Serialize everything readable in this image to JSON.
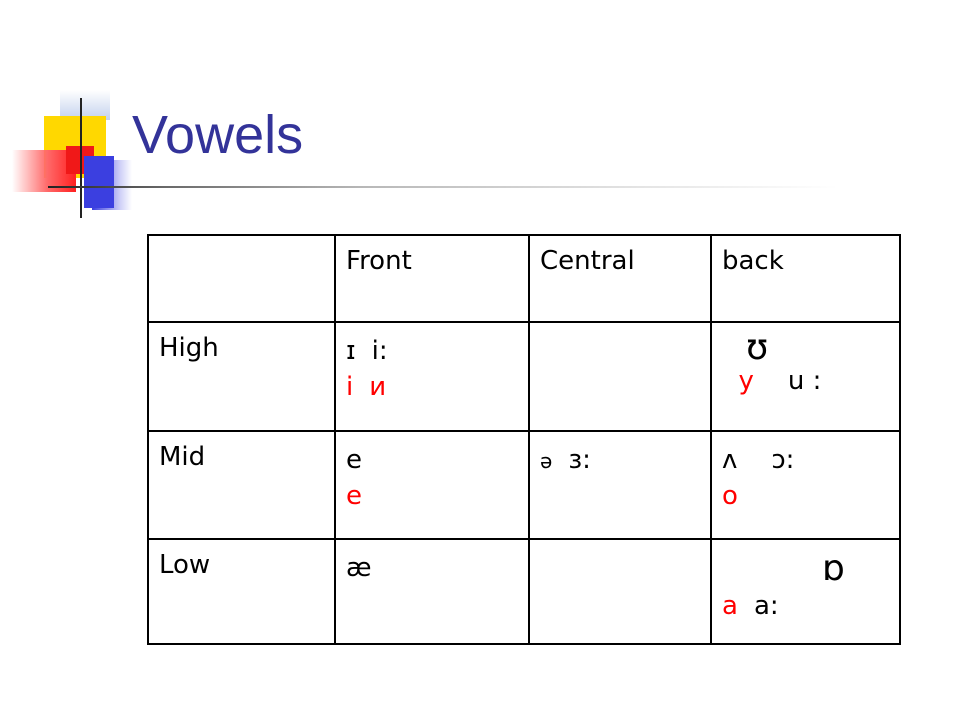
{
  "slide": {
    "title": "Vowels"
  },
  "table": {
    "header": [
      "",
      "Front",
      "Central",
      "back"
    ],
    "rows": [
      {
        "label": "High",
        "front": {
          "ipa": [
            "ɪ",
            "i:"
          ],
          "cyrillic": [
            "i",
            "и"
          ]
        },
        "central": {},
        "back": {
          "ipa_top": "ʊ",
          "cyrillic": "у",
          "ipa": "u :"
        }
      },
      {
        "label": "Mid",
        "front": {
          "ipa": "e",
          "cyrillic": "е"
        },
        "central": {
          "ipa": [
            "ə",
            "ɜ:"
          ]
        },
        "back": {
          "ipa": [
            "ʌ",
            "ɔ:"
          ],
          "cyrillic": "о"
        }
      },
      {
        "label": "Low",
        "front": {
          "ipa": "æ"
        },
        "central": {},
        "back": {
          "ipa_top": "ɒ",
          "cyrillic": "а",
          "ipa": "a:"
        }
      }
    ]
  },
  "colors": {
    "title": "#333399",
    "highlight": "#ff0000"
  }
}
